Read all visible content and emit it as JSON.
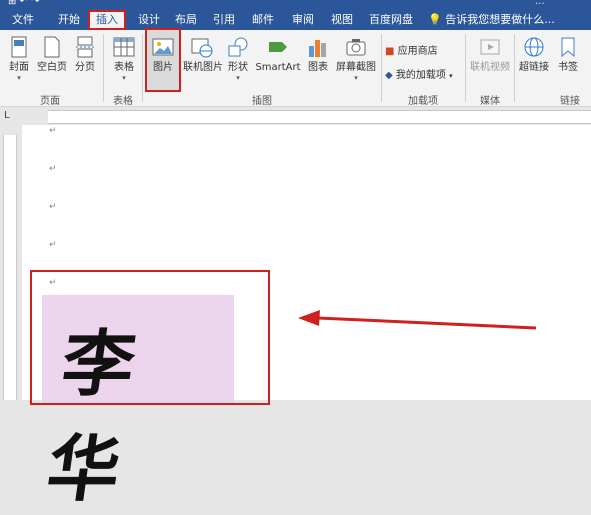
{
  "tabs": [
    "文件",
    "开始",
    "插入",
    "设计",
    "布局",
    "引用",
    "邮件",
    "审阅",
    "视图",
    "百度网盘"
  ],
  "active_tab": "插入",
  "search_placeholder": "告诉我您想要做什么...",
  "title_fragment": "...",
  "ribbon": {
    "cover_label": "封面",
    "blank_label": "空白页",
    "break_label": "分页",
    "table_label": "表格",
    "picture_label": "图片",
    "online_picture_label": "联机图片",
    "shapes_label": "形状",
    "smartart_label": "SmartArt",
    "chart_label": "图表",
    "screenshot_label": "屏幕截图",
    "store_label": "应用商店",
    "my_addins_label": "我的加载项",
    "online_video_label": "联机视频",
    "hyperlink_label": "超链接",
    "bookmark_label": "书签"
  },
  "groups": {
    "pages": "页面",
    "tables": "表格",
    "illustrations": "插图",
    "addins": "加载项",
    "media": "媒体",
    "links": "链接"
  },
  "ruler_corner": "L",
  "paragraph_mark": "↵",
  "signature_text": "李华",
  "colors": {
    "ribbon_blue": "#2b579a",
    "highlight_red": "#d0201d",
    "signature_bg": "#ecd4ec"
  }
}
